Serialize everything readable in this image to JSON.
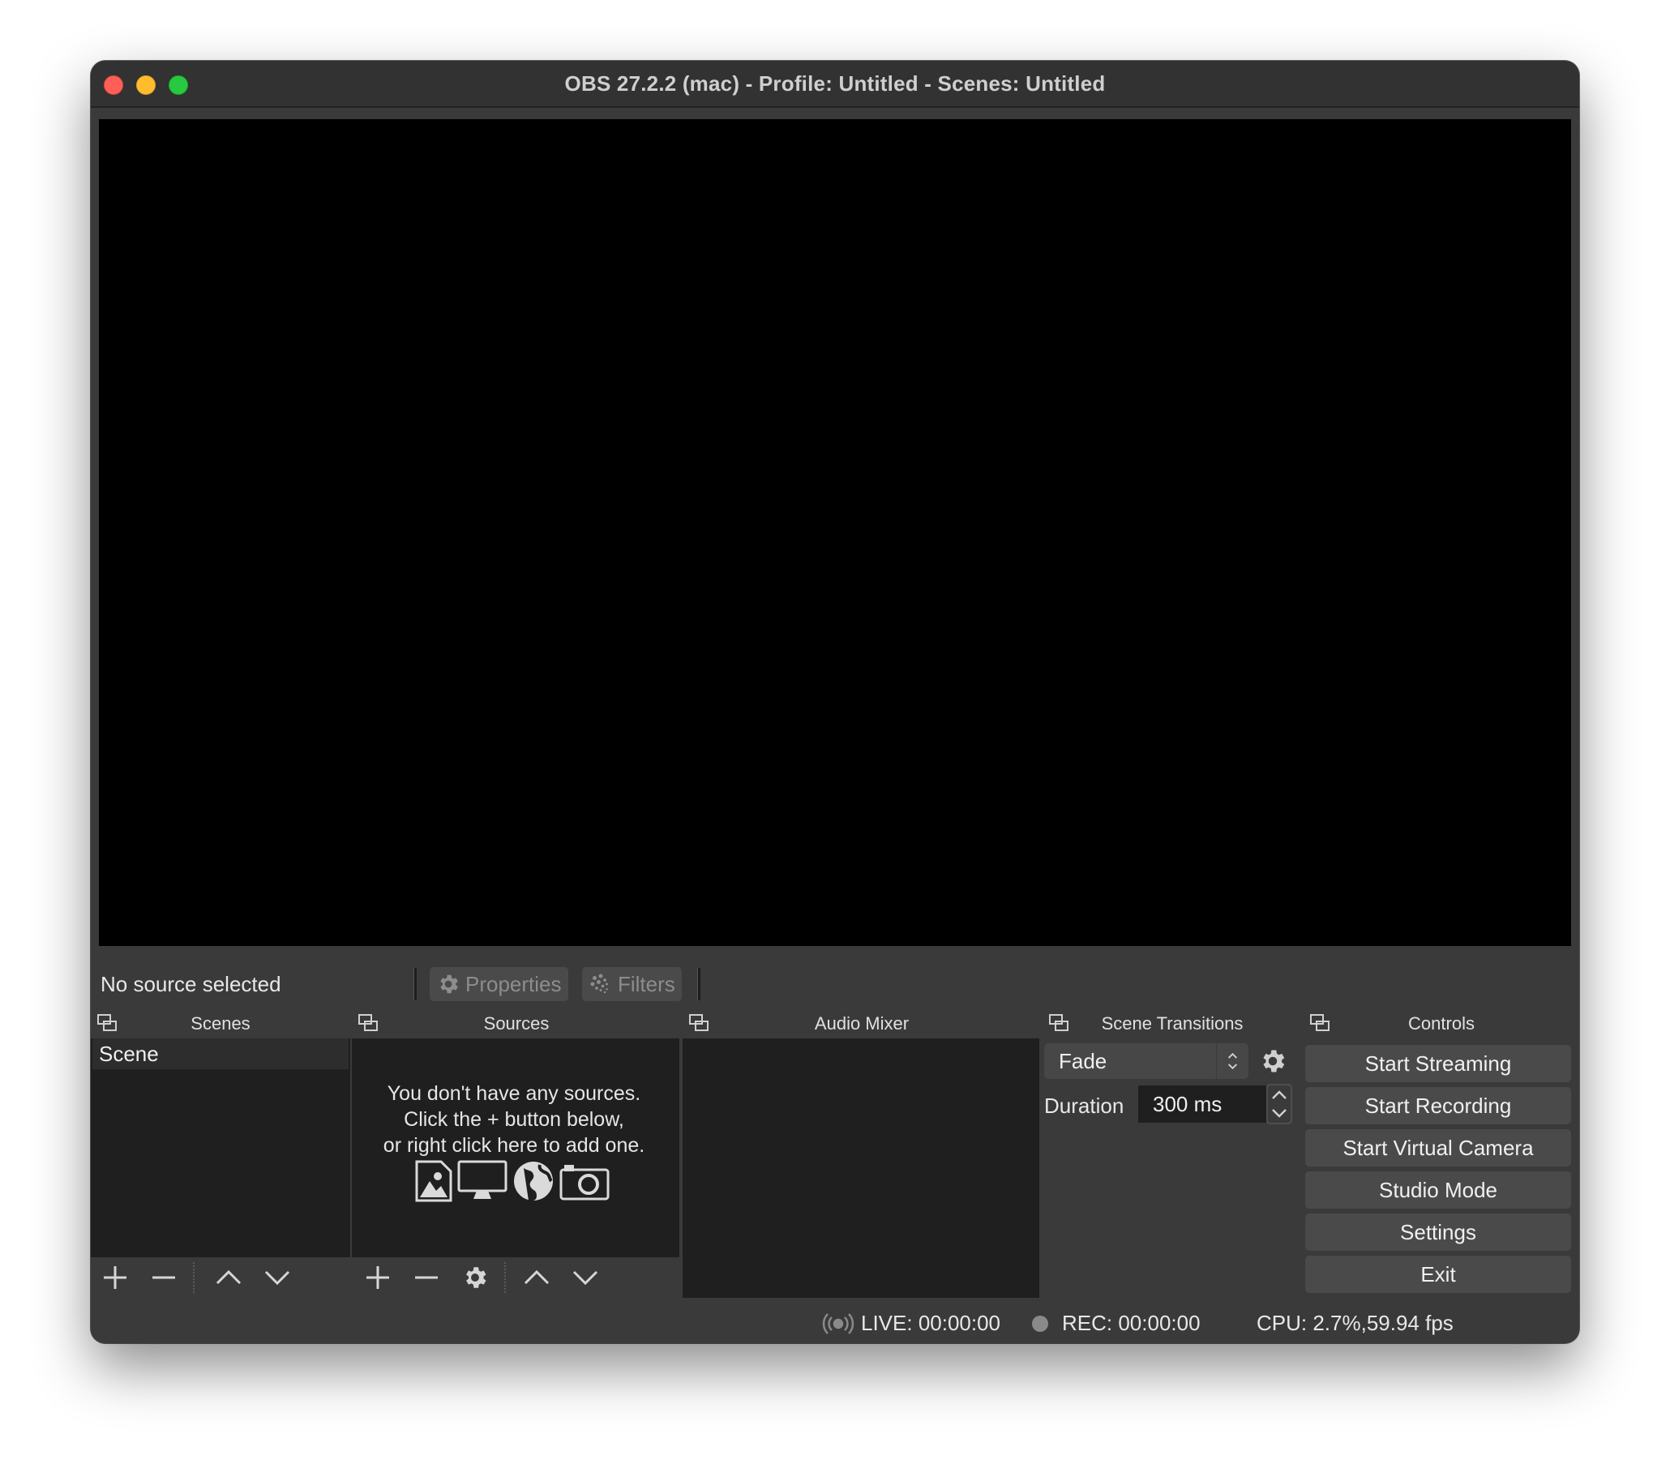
{
  "window": {
    "title": "OBS 27.2.2 (mac) - Profile: Untitled - Scenes: Untitled"
  },
  "context_bar": {
    "source_label": "No source selected",
    "properties_label": "Properties",
    "filters_label": "Filters"
  },
  "docks": {
    "scenes": {
      "title": "Scenes",
      "items": [
        {
          "label": "Scene"
        }
      ]
    },
    "sources": {
      "title": "Sources",
      "empty_line1": "You don't have any sources.",
      "empty_line2": "Click the + button below,",
      "empty_line3": "or right click here to add one."
    },
    "audio_mixer": {
      "title": "Audio Mixer"
    },
    "scene_transitions": {
      "title": "Scene Transitions",
      "transition": "Fade",
      "duration_label": "Duration",
      "duration_value": "300 ms"
    },
    "controls": {
      "title": "Controls",
      "buttons": [
        {
          "label": "Start Streaming"
        },
        {
          "label": "Start Recording"
        },
        {
          "label": "Start Virtual Camera"
        },
        {
          "label": "Studio Mode"
        },
        {
          "label": "Settings"
        },
        {
          "label": "Exit"
        }
      ]
    }
  },
  "status": {
    "live": "LIVE: 00:00:00",
    "rec": "REC: 00:00:00",
    "cpu": "CPU: 2.7%,59.94 fps"
  },
  "icons": {
    "toolbar": [
      "add-icon",
      "remove-icon",
      "gear-icon",
      "move-up-icon",
      "move-down-icon"
    ],
    "empty_sources": [
      "image-icon",
      "display-icon",
      "globe-icon",
      "camera-icon"
    ]
  },
  "colors": {
    "window_bg": "#3a3a3a",
    "panel_bg": "#1f1f1f",
    "preview_bg": "#000000",
    "close": "#fe5f57",
    "minimize": "#febc2e",
    "maximize": "#28c840"
  }
}
